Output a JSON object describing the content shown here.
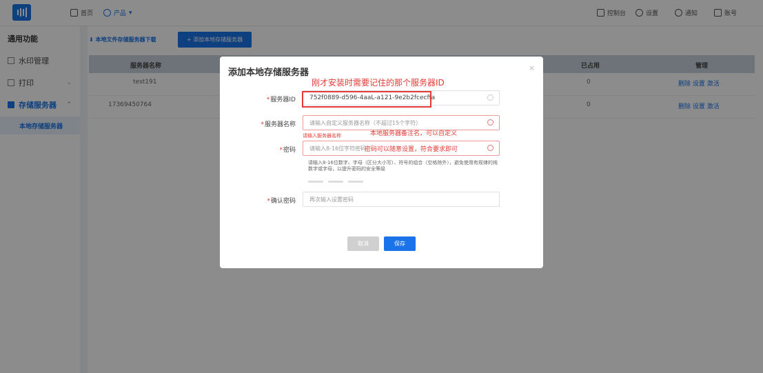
{
  "header": {
    "home_label": "首页",
    "product_label": "产品",
    "right_items": [
      "控制台",
      "设置",
      "通知",
      "账号"
    ]
  },
  "sidebar": {
    "title": "通用功能",
    "items": [
      {
        "label": "水印管理",
        "icon": "watermark-icon"
      },
      {
        "label": "打印",
        "icon": "printer-icon"
      },
      {
        "label": "存储服务器",
        "icon": "server-icon"
      }
    ],
    "sub_item": "本地存储服务器"
  },
  "toolbar": {
    "download_label": "本地文件存储服务器下载",
    "add_label": "+ 添加本地存储服务器"
  },
  "table": {
    "headers": [
      "服务器名称",
      "已占用",
      "管理"
    ],
    "rows": [
      {
        "name": "test191",
        "used": "0",
        "ops": "删除  设置  激活"
      },
      {
        "name": "17369450764",
        "used": "0",
        "ops": "删除  设置  激活"
      }
    ]
  },
  "modal": {
    "title": "添加本地存储服务器",
    "close": "×",
    "fields": {
      "server_id": {
        "label": "服务器ID",
        "value": "752f0889-d596-4aaL-a121-9e2b2fcecffa"
      },
      "server_name": {
        "label": "服务器名称",
        "placeholder": "请输入自定义服务器名称（不超过15个字符）",
        "error": "请输入服务器名称"
      },
      "password": {
        "label": "密码",
        "placeholder": "请输入8-16位字符密码",
        "hint": "请输入8-16位数字、字母（区分大小写）、符号的组合（空格除外），避免使用有规律的纯数字或字母，以提升密码的安全等级"
      },
      "confirm": {
        "label": "确认密码",
        "placeholder": "再次输入设置密码"
      }
    },
    "cancel_label": "取消",
    "save_label": "保存",
    "annotations": {
      "id": "刚才安装时需要记住的那个服务器ID",
      "name": "本地服务器备注名，可以自定义",
      "password": "密码可以随意设置，符合要求即可"
    }
  },
  "colors": {
    "primary": "#1a73e8",
    "annotation": "#e53935"
  }
}
